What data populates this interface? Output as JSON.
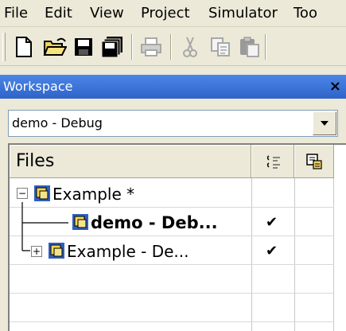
{
  "menu": [
    "File",
    "Edit",
    "View",
    "Project",
    "Simulator",
    "Too"
  ],
  "toolbar": {
    "buttons": [
      "new-file-icon",
      "open-folder-icon",
      "save-icon",
      "save-all-icon",
      "print-icon",
      "cut-icon",
      "copy-icon",
      "paste-icon"
    ]
  },
  "workspace": {
    "title": "Workspace",
    "close": "×",
    "config": "demo - Debug"
  },
  "tree": {
    "header": "Files",
    "rows": [
      {
        "label": "Example *",
        "check": ""
      },
      {
        "label": "demo - Deb...",
        "check": "✔"
      },
      {
        "label": "Example - De...",
        "check": "✔"
      }
    ]
  }
}
